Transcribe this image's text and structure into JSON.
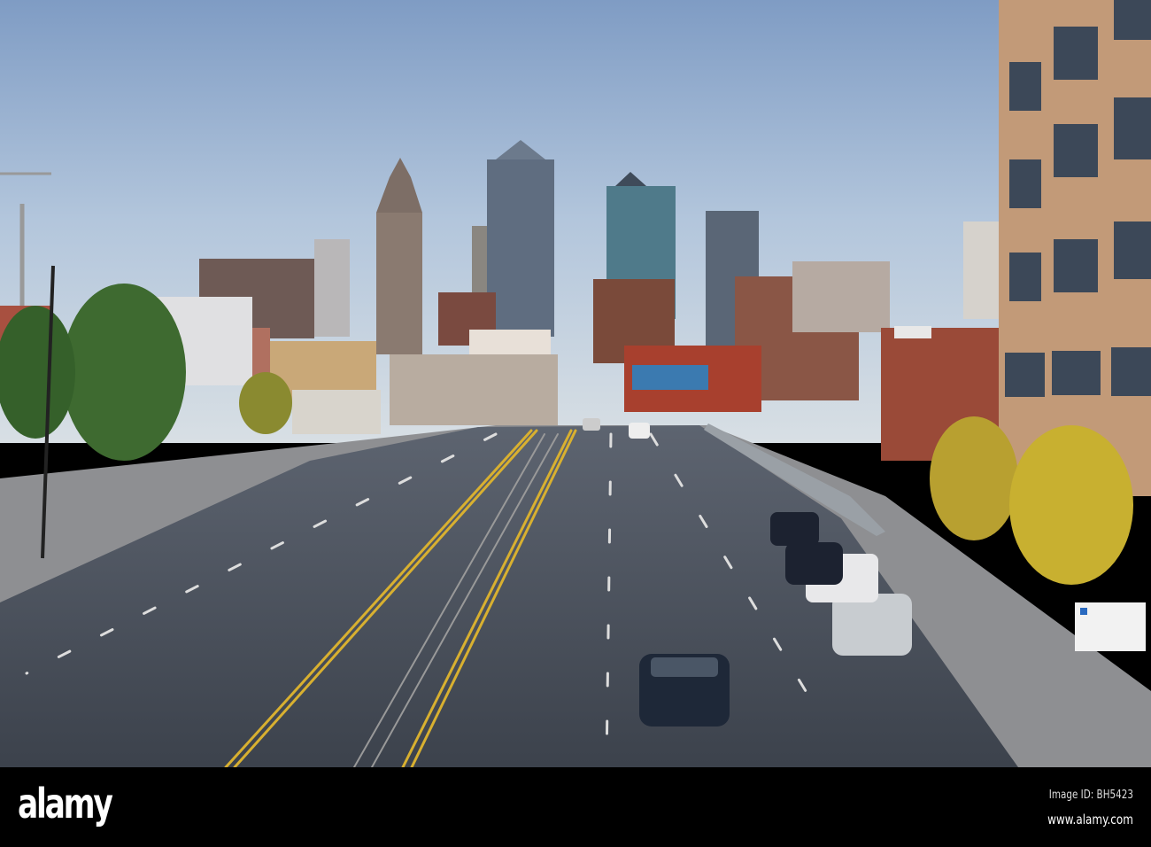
{
  "photo": {
    "subject": "city skyline street view"
  },
  "footer": {
    "logo": "alamy",
    "image_id": "Image ID: BH5423",
    "website": "www.alamy.com"
  }
}
